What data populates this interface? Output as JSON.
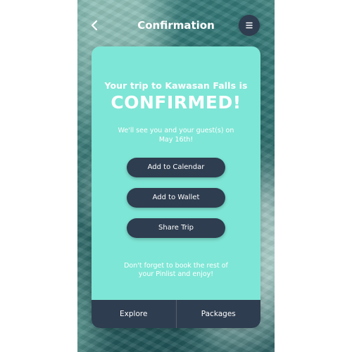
{
  "header": {
    "title": "Confirmation",
    "back_icon": "chevron-left-icon",
    "menu_icon": "menu-icon"
  },
  "confirmation": {
    "headline": "Your trip to Kawasan Falls is",
    "status": "CONFIRMED!",
    "message": "We'll see you and your guest(s) on May 16th!"
  },
  "actions": {
    "add_to_calendar": "Add to Calendar",
    "add_to_wallet": "Add to Wallet",
    "share_trip": "Share Trip"
  },
  "footer": {
    "message": "Don't forget to book the rest of your Pinlist and enjoy!"
  },
  "bottom_nav": {
    "explore": "Explore",
    "packages": "Packages"
  },
  "colors": {
    "accent": "#7ee6d6",
    "dark": "#2f3d50",
    "text": "#ffffff"
  }
}
